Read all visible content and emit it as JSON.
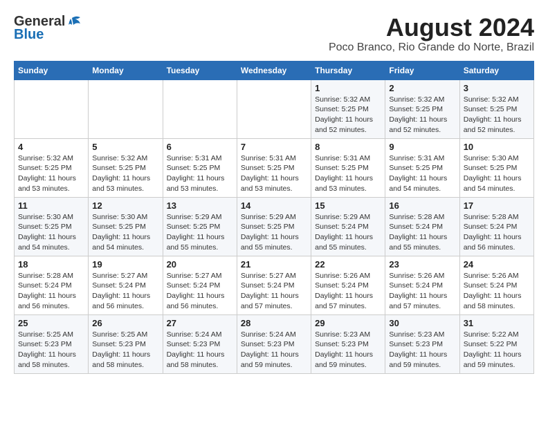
{
  "header": {
    "logo": {
      "general": "General",
      "blue": "Blue",
      "bird_color": "#1a6fb5"
    },
    "title": "August 2024",
    "location": "Poco Branco, Rio Grande do Norte, Brazil"
  },
  "calendar": {
    "days_of_week": [
      "Sunday",
      "Monday",
      "Tuesday",
      "Wednesday",
      "Thursday",
      "Friday",
      "Saturday"
    ],
    "weeks": [
      [
        {
          "day": "",
          "info": ""
        },
        {
          "day": "",
          "info": ""
        },
        {
          "day": "",
          "info": ""
        },
        {
          "day": "",
          "info": ""
        },
        {
          "day": "1",
          "info": "Sunrise: 5:32 AM\nSunset: 5:25 PM\nDaylight: 11 hours\nand 52 minutes."
        },
        {
          "day": "2",
          "info": "Sunrise: 5:32 AM\nSunset: 5:25 PM\nDaylight: 11 hours\nand 52 minutes."
        },
        {
          "day": "3",
          "info": "Sunrise: 5:32 AM\nSunset: 5:25 PM\nDaylight: 11 hours\nand 52 minutes."
        }
      ],
      [
        {
          "day": "4",
          "info": "Sunrise: 5:32 AM\nSunset: 5:25 PM\nDaylight: 11 hours\nand 53 minutes."
        },
        {
          "day": "5",
          "info": "Sunrise: 5:32 AM\nSunset: 5:25 PM\nDaylight: 11 hours\nand 53 minutes."
        },
        {
          "day": "6",
          "info": "Sunrise: 5:31 AM\nSunset: 5:25 PM\nDaylight: 11 hours\nand 53 minutes."
        },
        {
          "day": "7",
          "info": "Sunrise: 5:31 AM\nSunset: 5:25 PM\nDaylight: 11 hours\nand 53 minutes."
        },
        {
          "day": "8",
          "info": "Sunrise: 5:31 AM\nSunset: 5:25 PM\nDaylight: 11 hours\nand 53 minutes."
        },
        {
          "day": "9",
          "info": "Sunrise: 5:31 AM\nSunset: 5:25 PM\nDaylight: 11 hours\nand 54 minutes."
        },
        {
          "day": "10",
          "info": "Sunrise: 5:30 AM\nSunset: 5:25 PM\nDaylight: 11 hours\nand 54 minutes."
        }
      ],
      [
        {
          "day": "11",
          "info": "Sunrise: 5:30 AM\nSunset: 5:25 PM\nDaylight: 11 hours\nand 54 minutes."
        },
        {
          "day": "12",
          "info": "Sunrise: 5:30 AM\nSunset: 5:25 PM\nDaylight: 11 hours\nand 54 minutes."
        },
        {
          "day": "13",
          "info": "Sunrise: 5:29 AM\nSunset: 5:25 PM\nDaylight: 11 hours\nand 55 minutes."
        },
        {
          "day": "14",
          "info": "Sunrise: 5:29 AM\nSunset: 5:25 PM\nDaylight: 11 hours\nand 55 minutes."
        },
        {
          "day": "15",
          "info": "Sunrise: 5:29 AM\nSunset: 5:24 PM\nDaylight: 11 hours\nand 55 minutes."
        },
        {
          "day": "16",
          "info": "Sunrise: 5:28 AM\nSunset: 5:24 PM\nDaylight: 11 hours\nand 55 minutes."
        },
        {
          "day": "17",
          "info": "Sunrise: 5:28 AM\nSunset: 5:24 PM\nDaylight: 11 hours\nand 56 minutes."
        }
      ],
      [
        {
          "day": "18",
          "info": "Sunrise: 5:28 AM\nSunset: 5:24 PM\nDaylight: 11 hours\nand 56 minutes."
        },
        {
          "day": "19",
          "info": "Sunrise: 5:27 AM\nSunset: 5:24 PM\nDaylight: 11 hours\nand 56 minutes."
        },
        {
          "day": "20",
          "info": "Sunrise: 5:27 AM\nSunset: 5:24 PM\nDaylight: 11 hours\nand 56 minutes."
        },
        {
          "day": "21",
          "info": "Sunrise: 5:27 AM\nSunset: 5:24 PM\nDaylight: 11 hours\nand 57 minutes."
        },
        {
          "day": "22",
          "info": "Sunrise: 5:26 AM\nSunset: 5:24 PM\nDaylight: 11 hours\nand 57 minutes."
        },
        {
          "day": "23",
          "info": "Sunrise: 5:26 AM\nSunset: 5:24 PM\nDaylight: 11 hours\nand 57 minutes."
        },
        {
          "day": "24",
          "info": "Sunrise: 5:26 AM\nSunset: 5:24 PM\nDaylight: 11 hours\nand 58 minutes."
        }
      ],
      [
        {
          "day": "25",
          "info": "Sunrise: 5:25 AM\nSunset: 5:23 PM\nDaylight: 11 hours\nand 58 minutes."
        },
        {
          "day": "26",
          "info": "Sunrise: 5:25 AM\nSunset: 5:23 PM\nDaylight: 11 hours\nand 58 minutes."
        },
        {
          "day": "27",
          "info": "Sunrise: 5:24 AM\nSunset: 5:23 PM\nDaylight: 11 hours\nand 58 minutes."
        },
        {
          "day": "28",
          "info": "Sunrise: 5:24 AM\nSunset: 5:23 PM\nDaylight: 11 hours\nand 59 minutes."
        },
        {
          "day": "29",
          "info": "Sunrise: 5:23 AM\nSunset: 5:23 PM\nDaylight: 11 hours\nand 59 minutes."
        },
        {
          "day": "30",
          "info": "Sunrise: 5:23 AM\nSunset: 5:23 PM\nDaylight: 11 hours\nand 59 minutes."
        },
        {
          "day": "31",
          "info": "Sunrise: 5:22 AM\nSunset: 5:22 PM\nDaylight: 11 hours\nand 59 minutes."
        }
      ]
    ]
  }
}
